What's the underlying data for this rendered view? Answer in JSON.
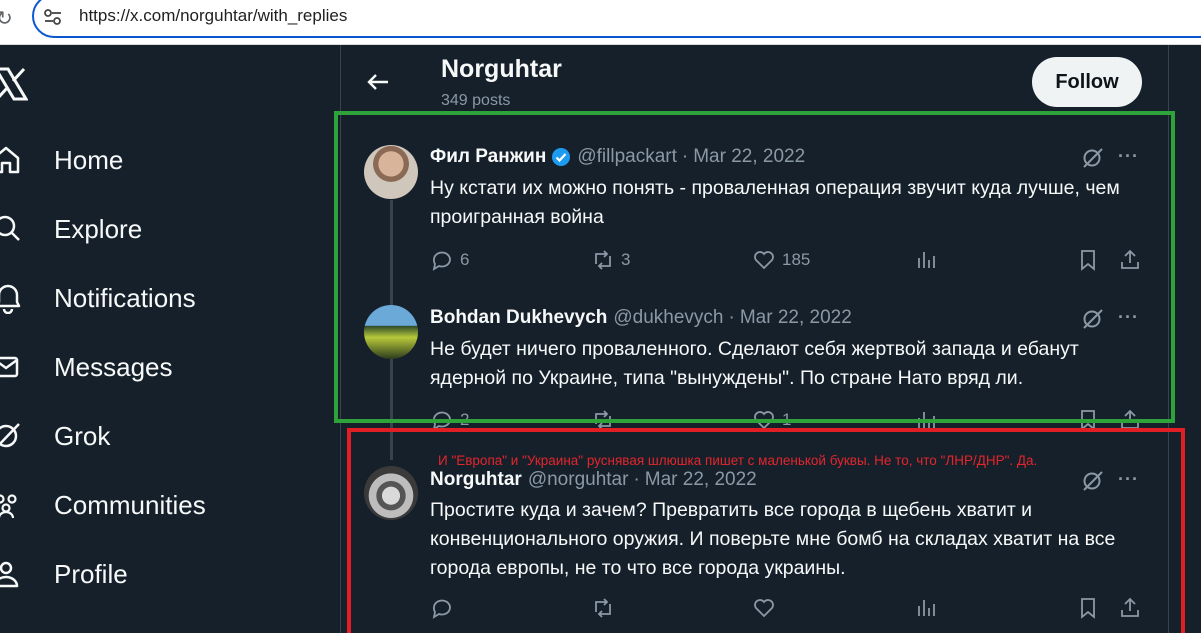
{
  "browser": {
    "url": "https://x.com/norguhtar/with_replies"
  },
  "sidebar": {
    "items": [
      {
        "label": "Home",
        "icon": "home-icon"
      },
      {
        "label": "Explore",
        "icon": "search-icon"
      },
      {
        "label": "Notifications",
        "icon": "bell-icon"
      },
      {
        "label": "Messages",
        "icon": "mail-icon"
      },
      {
        "label": "Grok",
        "icon": "grok-icon"
      },
      {
        "label": "Communities",
        "icon": "communities-icon"
      },
      {
        "label": "Profile",
        "icon": "person-icon"
      }
    ]
  },
  "header": {
    "title": "Norguhtar",
    "posts_count": "349 posts",
    "follow_label": "Follow"
  },
  "tweets": [
    {
      "name": "Фил Ранжин",
      "handle": "@fillpackart",
      "date": "Mar 22, 2022",
      "verified": true,
      "text": "Ну кстати их можно понять - проваленная операция звучит куда лучше, чем проигранная война",
      "replies": "6",
      "reposts": "3",
      "likes": "185"
    },
    {
      "name": "Bohdan Dukhevych",
      "handle": "@dukhevych",
      "date": "Mar 22, 2022",
      "verified": false,
      "text": "Не будет ничего проваленного. Сделают себя жертвой запада и ебанут ядерной по Украине, типа \"вынуждены\". По стране Нато вряд ли.",
      "replies": "2",
      "reposts": "",
      "likes": "1"
    },
    {
      "name": "Norguhtar",
      "handle": "@norguhtar",
      "date": "Mar 22, 2022",
      "verified": false,
      "text": "Простите куда и зачем? Превратить все города в щебень хватит и конвенционального оружия. И поверьте мне бомб на складах хватит на все города европы, не то что все города украины.",
      "replies": "",
      "reposts": "",
      "likes": ""
    }
  ],
  "annotation": {
    "text": "И \"Европа\" и \"Украина\" руснявая шлюшка пишет с маленькой буквы. Не то, что \"ЛНР/ДНР\". Да.",
    "color": "#e4252b"
  },
  "colors": {
    "background": "#15202b",
    "muted": "#8b98a5",
    "verified": "#1d9bf0",
    "green_box": "#2ea339",
    "red_box": "#e01e24"
  }
}
